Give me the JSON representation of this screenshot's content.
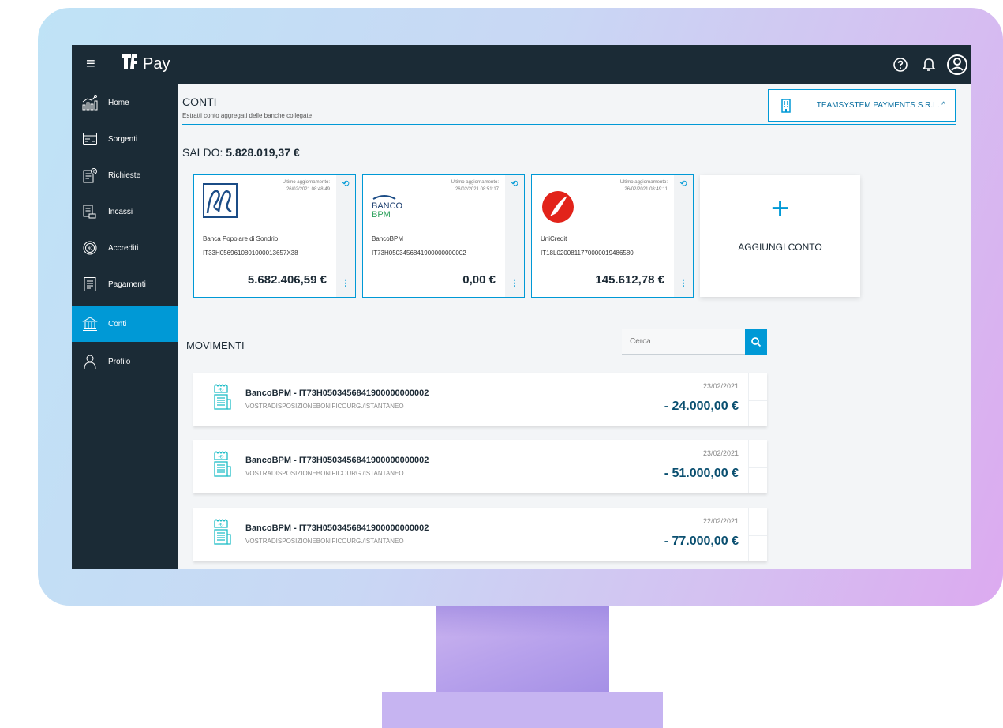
{
  "app": {
    "logo_text": "Pay",
    "logo_mark": "ts"
  },
  "header": {
    "icons": [
      "help-icon",
      "bell-icon",
      "user-avatar-icon"
    ]
  },
  "sidebar": {
    "items": [
      {
        "label": "Home",
        "icon": "home-chart-icon",
        "active": false
      },
      {
        "label": "Sorgenti",
        "icon": "sources-icon",
        "active": false
      },
      {
        "label": "Richieste",
        "icon": "requests-icon",
        "active": false
      },
      {
        "label": "Incassi",
        "icon": "collections-icon",
        "active": false
      },
      {
        "label": "Accrediti",
        "icon": "euro-coin-icon",
        "active": false
      },
      {
        "label": "Pagamenti",
        "icon": "payments-icon",
        "active": false
      },
      {
        "label": "Conti",
        "icon": "bank-icon",
        "active": true
      },
      {
        "label": "Profilo",
        "icon": "profile-icon",
        "active": false
      }
    ]
  },
  "page": {
    "title": "CONTI",
    "subtitle": "Estratti conto aggregati delle banche collegate",
    "company": "TEAMSYSTEM PAYMENTS S.R.L.",
    "saldo_label": "SALDO:",
    "saldo_value": "5.828.019,37 €"
  },
  "accounts": [
    {
      "name": "Banca Popolare di Sondrio",
      "iban": "IT33H0569610801000013657X38",
      "amount": "5.682.406,59 €",
      "update_label": "Ultimo aggiornamento:",
      "update_date": "26/02/2021 08:48:49",
      "logo": "popolare-sondrio-logo"
    },
    {
      "name": "BancoBPM",
      "iban": "IT73H0503456841900000000002",
      "amount": "0,00 €",
      "update_label": "Ultimo aggiornamento:",
      "update_date": "26/02/2021 08:51:17",
      "logo": "banco-bpm-logo",
      "logo_line1": "BANCO",
      "logo_line2": "BPM"
    },
    {
      "name": "UniCredit",
      "iban": "IT18L0200811770000019486580",
      "amount": "145.612,78 €",
      "update_label": "Ultimo aggiornamento:",
      "update_date": "26/02/2021 08:49:11",
      "logo": "unicredit-logo"
    }
  ],
  "add_account": {
    "label": "AGGIUNGI CONTO",
    "plus": "+"
  },
  "movements": {
    "title": "MOVIMENTI",
    "search_placeholder": "Cerca",
    "items": [
      {
        "title": "BancoBPM - IT73H0503456841900000000002",
        "description": "VOSTRADISPOSIZIONEBONIFICOURG./ISTANTANEO",
        "date": "23/02/2021",
        "amount": "- 24.000,00 €"
      },
      {
        "title": "BancoBPM - IT73H0503456841900000000002",
        "description": "VOSTRADISPOSIZIONEBONIFICOURG./ISTANTANEO",
        "date": "23/02/2021",
        "amount": "- 51.000,00 €"
      },
      {
        "title": "BancoBPM - IT73H0503456841900000000002",
        "description": "VOSTRADISPOSIZIONEBONIFICOURG./ISTANTANEO",
        "date": "22/02/2021",
        "amount": "- 77.000,00 €"
      }
    ]
  },
  "colors": {
    "accent": "#0099d6",
    "sidebar": "#1b2b36",
    "background": "#f3f5f7"
  }
}
